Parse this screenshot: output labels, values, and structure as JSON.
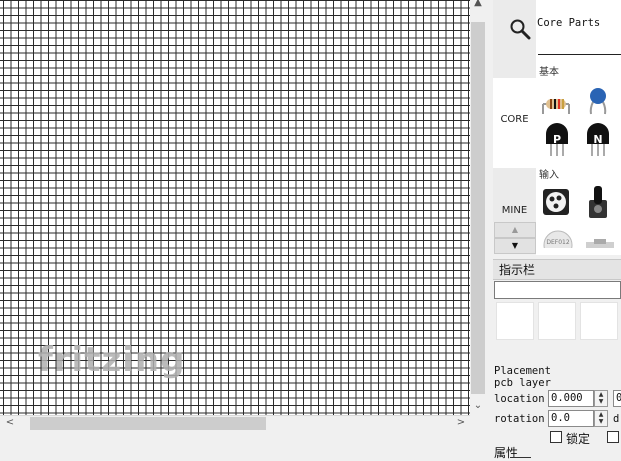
{
  "canvas": {
    "watermark": "fritzing"
  },
  "scrollbars": {
    "up_arrow": "▲",
    "down_arrow": "⌄",
    "left_arrow": "<",
    "right_arrow": ">"
  },
  "parts_bin": {
    "tabs": [
      {
        "label": "",
        "icon": "search-icon"
      },
      {
        "label": "CORE"
      },
      {
        "label": "MINE"
      }
    ],
    "title": "Core Parts",
    "sections": [
      {
        "label": "基本",
        "parts": [
          "resistor",
          "ceramic-capacitor",
          "pnp-transistor",
          "npn-transistor"
        ]
      },
      {
        "label": "输入",
        "parts": [
          "potentiometer",
          "rotary-potentiometer",
          "dip-switch",
          "pushbutton"
        ]
      }
    ],
    "scroll_up": "▲",
    "scroll_down": "▼"
  },
  "inspector": {
    "title": "指示栏",
    "placement_label": "Placement",
    "pcb_layer_label": "pcb layer",
    "location_label": "location",
    "location_value": "0.000",
    "location_value_2": "0",
    "rotation_label": "rotation",
    "rotation_value": "0.0",
    "rotation_unit": "d",
    "lock_label": "锁定",
    "properties_label": "属性"
  },
  "colors": {
    "grid_line": "#2a2a2a",
    "canvas_bg": "#ffffff",
    "panel_bg": "#f0f0f0",
    "transistor_body": "#111111",
    "capacitor_blue": "#2a64b4"
  }
}
